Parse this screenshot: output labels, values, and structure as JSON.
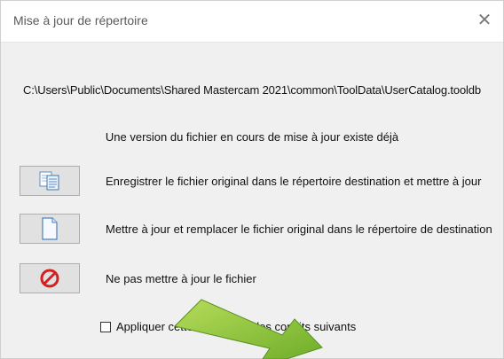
{
  "dialog": {
    "title": "Mise à jour de répertoire",
    "close_symbol": "✕",
    "path": "C:\\Users\\Public\\Documents\\Shared Mastercam 2021\\common\\ToolData\\UserCatalog.tooldb",
    "message": "Une version du fichier en cours de mise à jour existe déjà",
    "options": [
      {
        "icon": "copy-files-icon",
        "label": "Enregistrer le fichier original dans le répertoire destination et mettre à jour"
      },
      {
        "icon": "document-icon",
        "label": "Mettre à jour et remplacer le fichier original dans le répertoire de destination"
      },
      {
        "icon": "no-entry-icon",
        "label": "Ne pas mettre à jour le fichier"
      }
    ],
    "checkbox": {
      "label": "Appliquer cette action pour les conflits suivants",
      "checked": false
    }
  },
  "colors": {
    "dialog_bg": "#f0f0f0",
    "button_bg": "#e1e1e1",
    "no_entry_red": "#d21f1f",
    "arrow_green": "#8cc63f"
  },
  "overlay": {
    "arrow_icon": "green-annotation-arrow"
  }
}
